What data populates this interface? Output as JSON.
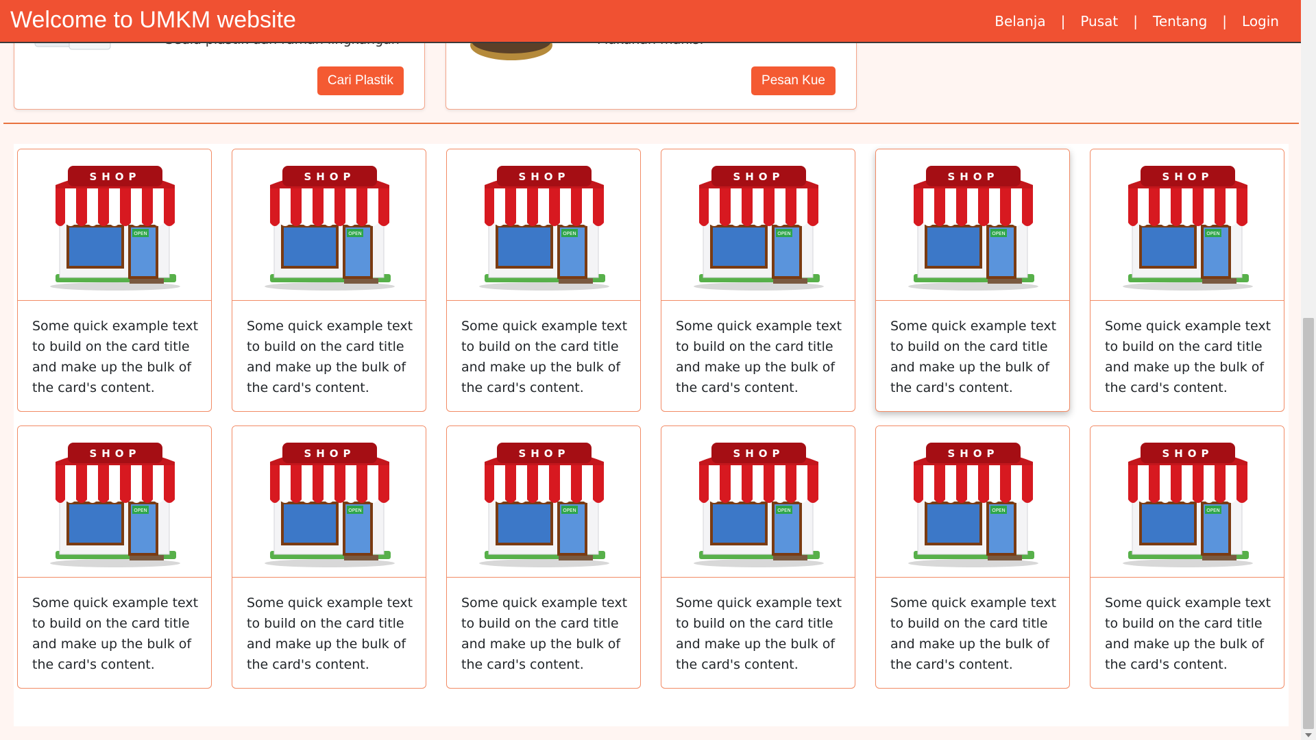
{
  "navbar": {
    "brand": "Welcome to UMKM website",
    "links": [
      "Belanja",
      "Pusat",
      "Tentang",
      "Login"
    ],
    "separator": "|"
  },
  "top_cards": [
    {
      "description": "Sedia plastik dan ramah lingkungan",
      "button_label": "Cari Plastik"
    },
    {
      "description": "Makanan manis.",
      "button_label": "Pesan Kue"
    }
  ],
  "shop_icon": {
    "sign_text": "SHOP",
    "open_text": "OPEN"
  },
  "cards": [
    {
      "text": "Some quick example text to build on the card title and make up the bulk of the card's content."
    },
    {
      "text": "Some quick example text to build on the card title and make up the bulk of the card's content."
    },
    {
      "text": "Some quick example text to build on the card title and make up the bulk of the card's content."
    },
    {
      "text": "Some quick example text to build on the card title and make up the bulk of the card's content."
    },
    {
      "text": "Some quick example text to build on the card title and make up the bulk of the card's content."
    },
    {
      "text": "Some quick example text to build on the card title and make up the bulk of the card's content."
    },
    {
      "text": "Some quick example text to build on the card title and make up the bulk of the card's content."
    },
    {
      "text": "Some quick example text to build on the card title and make up the bulk of the card's content."
    },
    {
      "text": "Some quick example text to build on the card title and make up the bulk of the card's content."
    },
    {
      "text": "Some quick example text to build on the card title and make up the bulk of the card's content."
    },
    {
      "text": "Some quick example text to build on the card title and make up the bulk of the card's content."
    },
    {
      "text": "Some quick example text to build on the card title and make up the bulk of the card's content."
    }
  ],
  "colors": {
    "primary": "#f05132",
    "button": "#f45a32",
    "card_border": "#f28a64",
    "awning_red": "#c4161c"
  }
}
